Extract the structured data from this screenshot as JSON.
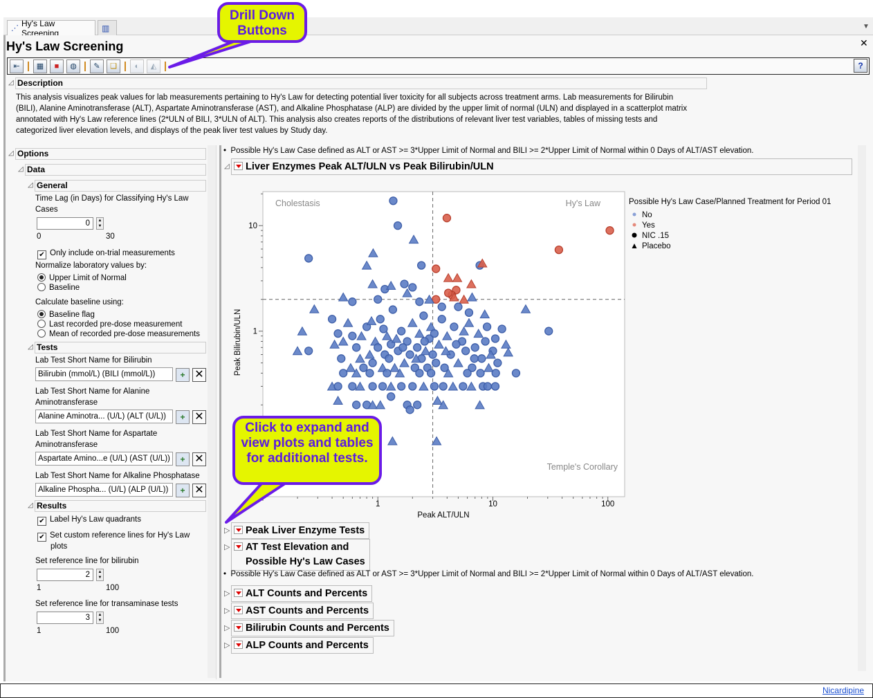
{
  "window": {
    "tab_label": "Hy's Law Screening",
    "title": "Hy's Law Screening",
    "help_label": "?"
  },
  "toolbar": {
    "buttons": [
      "subject-filter",
      "table-view",
      "graph-builder",
      "new-report",
      "add-comment",
      "copy-comment",
      "web-filter",
      "drill-down"
    ]
  },
  "description": {
    "header": "Description",
    "lines": [
      "This analysis visualizes peak values for lab measurements pertaining to Hy's Law for detecting potential liver toxicity for all subjects across treatment arms. Lab measurements for Bilirubin",
      "(BILI), Alanine Aminotransferase (ALT), Aspartate Aminotransferase (AST), and Alkaline Phosphatase (ALP) are divided by the upper limit of normal (ULN) and displayed in a scatterplot matrix",
      "annotated with Hy's Law reference lines (2*ULN of BILI, 3*ULN of ALT). This analysis also creates reports of the distributions of relevant liver test variables, tables of missing tests and",
      "categorized liver elevation levels, and displays of the peak liver test values by Study day."
    ]
  },
  "options": {
    "header": "Options",
    "data_header": "Data",
    "general_header": "General",
    "time_lag_label": "Time Lag (in Days) for Classifying Hy's Law Cases",
    "time_lag_label_1": "Time Lag (in Days) for Classifying Hy's Law",
    "time_lag_label_2": "Cases",
    "time_lag_value": "0",
    "time_lag_min": "0",
    "time_lag_max": "30",
    "on_trial_label": "Only include on-trial measurements",
    "on_trial_checked": true,
    "normalize_label": "Normalize laboratory values by:",
    "normalize_options": [
      "Upper Limit of Normal",
      "Baseline"
    ],
    "normalize_selected": 0,
    "baseline_label": "Calculate baseline using:",
    "baseline_options": [
      "Baseline flag",
      "Last recorded pre-dose measurement",
      "Mean of recorded pre-dose measurements"
    ],
    "baseline_selected": 0,
    "tests_header": "Tests",
    "tests": [
      {
        "label_1": "Lab Test Short Name for Bilirubin",
        "label_2": "",
        "value": "Bilirubin (mmol/L) (BILI (mmol/L))"
      },
      {
        "label_1": "Lab Test Short Name for Alanine",
        "label_2": "Aminotransferase",
        "value": "Alanine Aminotra... (U/L) (ALT (U/L))"
      },
      {
        "label_1": "Lab Test Short Name for Aspartate",
        "label_2": "Aminotransferase",
        "value": "Aspartate Amino...e (U/L) (AST (U/L))"
      },
      {
        "label_1": "Lab Test Short Name for Alkaline Phosphatase",
        "label_2": "",
        "value": "Alkaline Phospha... (U/L) (ALP (U/L))"
      }
    ],
    "results_header": "Results",
    "label_quadrants": "Label Hy's Law quadrants",
    "custom_ref_1": "Set custom reference lines for Hy's Law",
    "custom_ref_2": "plots",
    "bili_ref_label": "Set reference line for bilirubin",
    "bili_ref_value": "2",
    "bili_ref_min": "1",
    "bili_ref_max": "100",
    "trans_ref_label": "Set reference line for transaminase tests",
    "trans_ref_value": "3",
    "trans_ref_min": "1",
    "trans_ref_max": "100"
  },
  "report": {
    "note": "Possible Hy's Law Case defined as ALT or AST >= 3*Upper Limit of Normal and BILI >= 2*Upper Limit of Normal within 0 Days of ALT/AST elevation.",
    "plot_header": "Liver Enzymes Peak ALT/ULN vs Peak Bilirubin/ULN",
    "sections": [
      "Peak Liver Enzyme Tests",
      "AT Test Elevation and Possible Hy's Law Cases",
      "ALT Counts and Percents",
      "AST Counts and Percents",
      "Bilirubin Counts and Percents",
      "ALP Counts and Percents"
    ],
    "section_1_line1": "AT Test Elevation and",
    "section_1_line2": "Possible Hy's Law Cases"
  },
  "chart_data": {
    "type": "scatter",
    "title": "Liver Enzymes Peak ALT/ULN vs Peak Bilirubin/ULN",
    "xlabel": "Peak ALT/ULN",
    "ylabel": "Peak Bilirubin/ULN",
    "xscale": "log",
    "yscale": "log",
    "xlim": [
      0.1,
      140
    ],
    "ylim": [
      0.027,
      21
    ],
    "xticks": [
      "1",
      "10",
      "100"
    ],
    "xtick_values": [
      1,
      10,
      100
    ],
    "yticks": [
      "10",
      "1"
    ],
    "ytick_values": [
      10,
      1
    ],
    "reference_lines": {
      "x": 3,
      "y": 2
    },
    "quadrant_labels": [
      "Cholestasis",
      "Hy's Law",
      "Temple's Corollary"
    ],
    "legend": {
      "title": "Possible Hy's Law Case/Planned Treatment for Period 01",
      "position": "right",
      "entries": [
        {
          "label": "No",
          "color": "#6f8cc8",
          "marker": "dot"
        },
        {
          "label": "Yes",
          "color": "#e0705f",
          "marker": "dot"
        },
        {
          "label": "NIC .15",
          "marker": "circle"
        },
        {
          "label": "Placebo",
          "marker": "triangle"
        }
      ]
    },
    "colors": {
      "No": "#5b7cc4",
      "Yes": "#d9604c"
    },
    "point_fields": [
      "peak_alt_uln",
      "peak_bili_uln",
      "hys_law_case",
      "treatment"
    ],
    "points": [
      [
        1.36,
        17.2,
        "No",
        "NIC .15"
      ],
      [
        1.49,
        10,
        "No",
        "NIC .15"
      ],
      [
        2.05,
        7.4,
        "No",
        "Placebo"
      ],
      [
        0.25,
        4.9,
        "No",
        "NIC .15"
      ],
      [
        0.91,
        5.5,
        "No",
        "Placebo"
      ],
      [
        0.8,
        4.2,
        "No",
        "Placebo"
      ],
      [
        2.39,
        4.2,
        "No",
        "NIC .15"
      ],
      [
        3.98,
        11.8,
        "Yes",
        "NIC .15"
      ],
      [
        104,
        9.0,
        "Yes",
        "NIC .15"
      ],
      [
        37.5,
        5.9,
        "Yes",
        "NIC .15"
      ],
      [
        3.2,
        3.9,
        "Yes",
        "NIC .15"
      ],
      [
        7.7,
        4.2,
        "No",
        "NIC .15"
      ],
      [
        8.1,
        4.4,
        "Yes",
        "Placebo"
      ],
      [
        4.1,
        3.2,
        "Yes",
        "Placebo"
      ],
      [
        4.9,
        3.2,
        "Yes",
        "Placebo"
      ],
      [
        6.5,
        2.8,
        "Yes",
        "Placebo"
      ],
      [
        4.8,
        2.45,
        "Yes",
        "NIC .15"
      ],
      [
        4.4,
        2.2,
        "Yes",
        "NIC .15"
      ],
      [
        4.1,
        2.3,
        "Yes",
        "NIC .15"
      ],
      [
        5.6,
        2.0,
        "Yes",
        "Placebo"
      ],
      [
        3.2,
        2.0,
        "Yes",
        "NIC .15"
      ],
      [
        4.6,
        2.1,
        "Yes",
        "Placebo"
      ],
      [
        19.3,
        1.62,
        "No",
        "Placebo"
      ],
      [
        30.6,
        1.0,
        "No",
        "NIC .15"
      ],
      [
        1.34,
        0.091,
        "No",
        "Placebo"
      ],
      [
        3.24,
        0.091,
        "No",
        "Placebo"
      ],
      [
        0.28,
        1.62,
        "No",
        "Placebo"
      ],
      [
        0.22,
        1.0,
        "No",
        "Placebo"
      ],
      [
        0.2,
        0.65,
        "No",
        "Placebo"
      ],
      [
        0.25,
        0.65,
        "No",
        "NIC .15"
      ],
      [
        15.9,
        0.4,
        "No",
        "NIC .15"
      ],
      [
        7.7,
        0.2,
        "No",
        "Placebo"
      ],
      [
        0.9,
        2.8,
        "No",
        "Placebo"
      ],
      [
        1.15,
        2.5,
        "No",
        "NIC .15"
      ],
      [
        1.3,
        2.7,
        "No",
        "Placebo"
      ],
      [
        1.7,
        2.8,
        "No",
        "NIC .15"
      ],
      [
        2.0,
        2.6,
        "No",
        "NIC .15"
      ],
      [
        1.8,
        2.3,
        "No",
        "Placebo"
      ],
      [
        1.0,
        2.0,
        "No",
        "NIC .15"
      ],
      [
        0.5,
        2.1,
        "No",
        "Placebo"
      ],
      [
        0.6,
        1.9,
        "No",
        "NIC .15"
      ],
      [
        2.3,
        1.9,
        "No",
        "NIC .15"
      ],
      [
        6.6,
        2.1,
        "No",
        "Placebo"
      ],
      [
        2.8,
        2.0,
        "No",
        "Placebo"
      ],
      [
        3.6,
        1.7,
        "No",
        "NIC .15"
      ],
      [
        5.0,
        1.7,
        "No",
        "NIC .15"
      ],
      [
        6.2,
        1.5,
        "No",
        "NIC .15"
      ],
      [
        8.5,
        1.45,
        "No",
        "Placebo"
      ],
      [
        0.4,
        1.3,
        "No",
        "NIC .15"
      ],
      [
        0.45,
        0.95,
        "No",
        "NIC .15"
      ],
      [
        0.5,
        0.8,
        "No",
        "Placebo"
      ],
      [
        0.55,
        1.2,
        "No",
        "Placebo"
      ],
      [
        0.6,
        0.9,
        "No",
        "NIC .15"
      ],
      [
        0.65,
        0.7,
        "No",
        "NIC .15"
      ],
      [
        0.7,
        0.55,
        "No",
        "Placebo"
      ],
      [
        0.75,
        0.45,
        "No",
        "NIC .15"
      ],
      [
        0.8,
        1.1,
        "No",
        "NIC .15"
      ],
      [
        0.85,
        0.6,
        "No",
        "Placebo"
      ],
      [
        0.9,
        0.5,
        "No",
        "NIC .15"
      ],
      [
        0.95,
        0.8,
        "No",
        "Placebo"
      ],
      [
        1.0,
        0.7,
        "No",
        "NIC .15"
      ],
      [
        1.05,
        1.3,
        "No",
        "NIC .15"
      ],
      [
        1.1,
        0.45,
        "No",
        "Placebo"
      ],
      [
        1.15,
        0.6,
        "No",
        "NIC .15"
      ],
      [
        1.2,
        0.9,
        "No",
        "Placebo"
      ],
      [
        1.25,
        0.55,
        "No",
        "NIC .15"
      ],
      [
        1.3,
        0.75,
        "No",
        "NIC .15"
      ],
      [
        1.35,
        1.6,
        "No",
        "NIC .15"
      ],
      [
        1.4,
        0.45,
        "No",
        "Placebo"
      ],
      [
        1.5,
        0.65,
        "No",
        "NIC .15"
      ],
      [
        1.6,
        1.0,
        "No",
        "NIC .15"
      ],
      [
        1.7,
        0.5,
        "No",
        "Placebo"
      ],
      [
        1.8,
        0.8,
        "No",
        "NIC .15"
      ],
      [
        1.9,
        0.6,
        "No",
        "NIC .15"
      ],
      [
        2.0,
        1.2,
        "No",
        "Placebo"
      ],
      [
        2.1,
        0.45,
        "No",
        "NIC .15"
      ],
      [
        2.2,
        0.7,
        "No",
        "NIC .15"
      ],
      [
        2.3,
        0.95,
        "No",
        "Placebo"
      ],
      [
        2.4,
        0.55,
        "No",
        "NIC .15"
      ],
      [
        2.5,
        1.4,
        "No",
        "NIC .15"
      ],
      [
        2.6,
        0.65,
        "No",
        "Placebo"
      ],
      [
        2.7,
        0.45,
        "No",
        "NIC .15"
      ],
      [
        2.8,
        0.85,
        "No",
        "NIC .15"
      ],
      [
        2.9,
        1.1,
        "No",
        "Placebo"
      ],
      [
        3.0,
        0.6,
        "No",
        "NIC .15"
      ],
      [
        3.2,
        0.5,
        "No",
        "NIC .15"
      ],
      [
        3.4,
        0.75,
        "No",
        "Placebo"
      ],
      [
        3.6,
        1.3,
        "No",
        "NIC .15"
      ],
      [
        3.8,
        0.45,
        "No",
        "NIC .15"
      ],
      [
        4.0,
        0.9,
        "No",
        "Placebo"
      ],
      [
        4.3,
        0.6,
        "No",
        "NIC .15"
      ],
      [
        4.6,
        1.1,
        "No",
        "NIC .15"
      ],
      [
        5.0,
        0.5,
        "No",
        "Placebo"
      ],
      [
        5.4,
        0.8,
        "No",
        "NIC .15"
      ],
      [
        5.8,
        0.65,
        "No",
        "NIC .15"
      ],
      [
        6.2,
        1.2,
        "No",
        "Placebo"
      ],
      [
        6.6,
        0.45,
        "No",
        "NIC .15"
      ],
      [
        7.0,
        0.7,
        "No",
        "NIC .15"
      ],
      [
        7.5,
        0.95,
        "No",
        "Placebo"
      ],
      [
        8.0,
        0.55,
        "No",
        "NIC .15"
      ],
      [
        8.6,
        0.8,
        "No",
        "NIC .15"
      ],
      [
        9.2,
        0.45,
        "No",
        "Placebo"
      ],
      [
        10,
        0.65,
        "No",
        "NIC .15"
      ],
      [
        11,
        0.5,
        "No",
        "NIC .15"
      ],
      [
        12,
        1.05,
        "No",
        "NIC .15"
      ],
      [
        13,
        0.75,
        "No",
        "Placebo"
      ],
      [
        0.42,
        0.75,
        "No",
        "Placebo"
      ],
      [
        0.48,
        0.55,
        "No",
        "NIC .15"
      ],
      [
        0.58,
        0.45,
        "No",
        "Placebo"
      ],
      [
        0.72,
        0.9,
        "No",
        "Placebo"
      ],
      [
        0.88,
        1.25,
        "No",
        "Placebo"
      ],
      [
        1.12,
        1.05,
        "No",
        "NIC .15"
      ],
      [
        1.45,
        0.85,
        "No",
        "Placebo"
      ],
      [
        1.65,
        0.7,
        "No",
        "NIC .15"
      ],
      [
        2.15,
        0.55,
        "No",
        "Placebo"
      ],
      [
        2.55,
        0.8,
        "No",
        "NIC .15"
      ],
      [
        3.1,
        0.95,
        "No",
        "NIC .15"
      ],
      [
        3.9,
        0.65,
        "No",
        "Placebo"
      ],
      [
        4.8,
        0.75,
        "No",
        "NIC .15"
      ],
      [
        5.6,
        1.0,
        "No",
        "Placebo"
      ],
      [
        6.9,
        0.55,
        "No",
        "NIC .15"
      ],
      [
        8.9,
        1.1,
        "No",
        "NIC .15"
      ],
      [
        10.5,
        0.85,
        "No",
        "NIC .15"
      ],
      [
        9.6,
        0.6,
        "No",
        "Placebo"
      ],
      [
        0.4,
        0.3,
        "No",
        "Placebo"
      ],
      [
        0.45,
        0.3,
        "No",
        "NIC .15"
      ],
      [
        0.6,
        0.3,
        "No",
        "NIC .15"
      ],
      [
        0.7,
        0.3,
        "No",
        "Placebo"
      ],
      [
        0.9,
        0.3,
        "No",
        "NIC .15"
      ],
      [
        1.1,
        0.3,
        "No",
        "NIC .15"
      ],
      [
        1.3,
        0.3,
        "No",
        "Placebo"
      ],
      [
        1.6,
        0.3,
        "No",
        "NIC .15"
      ],
      [
        2.0,
        0.3,
        "No",
        "NIC .15"
      ],
      [
        2.5,
        0.3,
        "No",
        "Placebo"
      ],
      [
        3.1,
        0.3,
        "No",
        "NIC .15"
      ],
      [
        3.7,
        0.3,
        "No",
        "NIC .15"
      ],
      [
        4.5,
        0.3,
        "No",
        "Placebo"
      ],
      [
        5.5,
        0.3,
        "No",
        "NIC .15"
      ],
      [
        6.5,
        0.3,
        "No",
        "Placebo"
      ],
      [
        8.2,
        0.3,
        "No",
        "NIC .15"
      ],
      [
        9.0,
        0.3,
        "No",
        "NIC .15"
      ],
      [
        10.5,
        0.3,
        "No",
        "NIC .15"
      ],
      [
        0.45,
        0.22,
        "No",
        "Placebo"
      ],
      [
        0.65,
        0.2,
        "No",
        "NIC .15"
      ],
      [
        0.8,
        0.2,
        "No",
        "NIC .15"
      ],
      [
        0.9,
        0.2,
        "No",
        "Placebo"
      ],
      [
        1.05,
        0.2,
        "No",
        "Placebo"
      ],
      [
        1.3,
        0.24,
        "No",
        "NIC .15"
      ],
      [
        1.8,
        0.2,
        "No",
        "NIC .15"
      ],
      [
        1.9,
        0.18,
        "No",
        "NIC .15"
      ],
      [
        2.2,
        0.2,
        "No",
        "NIC .15"
      ],
      [
        3.3,
        0.22,
        "No",
        "Placebo"
      ],
      [
        3.7,
        0.2,
        "No",
        "Placebo"
      ],
      [
        0.5,
        0.4,
        "No",
        "NIC .15"
      ],
      [
        0.65,
        0.4,
        "No",
        "Placebo"
      ],
      [
        0.85,
        0.4,
        "No",
        "NIC .15"
      ],
      [
        1.2,
        0.4,
        "No",
        "NIC .15"
      ],
      [
        1.55,
        0.4,
        "No",
        "Placebo"
      ],
      [
        2.3,
        0.4,
        "No",
        "NIC .15"
      ],
      [
        2.9,
        0.4,
        "No",
        "NIC .15"
      ],
      [
        4.1,
        0.4,
        "No",
        "Placebo"
      ],
      [
        6.0,
        0.4,
        "No",
        "NIC .15"
      ],
      [
        7.8,
        0.4,
        "No",
        "NIC .15"
      ],
      [
        10.6,
        0.4,
        "No",
        "NIC .15"
      ],
      [
        13.6,
        0.63,
        "No",
        "Placebo"
      ]
    ]
  },
  "callouts": {
    "drill_down": "Drill Down Buttons",
    "expand": "Click to expand and view plots and tables for additional tests."
  },
  "status": {
    "link": "Nicardipine"
  }
}
